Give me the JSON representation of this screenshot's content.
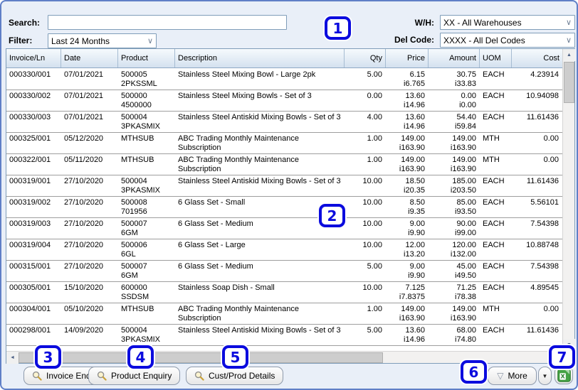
{
  "filters": {
    "search_label": "Search:",
    "search_value": "",
    "filter_label": "Filter:",
    "filter_value": "Last 24 Months",
    "wh_label": "W/H:",
    "wh_value": "XX - All Warehouses",
    "delcode_label": "Del Code:",
    "delcode_value": "XXXX - All Del Codes"
  },
  "table": {
    "columns": [
      "Invoice/Ln",
      "Date",
      "Product",
      "Description",
      "Qty",
      "Price",
      "Amount",
      "UOM",
      "Cost"
    ],
    "rows": [
      {
        "invoice": "000330/001",
        "date": "07/01/2021",
        "product": [
          "500005",
          "2PKSSML"
        ],
        "description": "Stainless Steel Mixing Bowl - Large 2pk",
        "qty": "5.00",
        "price": [
          "6.15",
          "i6.765"
        ],
        "amount": [
          "30.75",
          "i33.83"
        ],
        "uom": "EACH",
        "cost": "4.23914"
      },
      {
        "invoice": "000330/002",
        "date": "07/01/2021",
        "product": [
          "500000",
          "4500000"
        ],
        "description": "Stainless Steel Mixing Bowls - Set of 3",
        "qty": "0.00",
        "price": [
          "13.60",
          "i14.96"
        ],
        "amount": [
          "0.00",
          "i0.00"
        ],
        "uom": "EACH",
        "cost": "10.94098"
      },
      {
        "invoice": "000330/003",
        "date": "07/01/2021",
        "product": [
          "500004",
          "3PKASMIX"
        ],
        "description": "Stainless Steel Antiskid Mixing Bowls - Set of 3",
        "qty": "4.00",
        "price": [
          "13.60",
          "i14.96"
        ],
        "amount": [
          "54.40",
          "i59.84"
        ],
        "uom": "EACH",
        "cost": "11.61436"
      },
      {
        "invoice": "000325/001",
        "date": "05/12/2020",
        "product": [
          "MTHSUB"
        ],
        "description": "ABC Trading Monthly Maintenance Subscription",
        "qty": "1.00",
        "price": [
          "149.00",
          "i163.90"
        ],
        "amount": [
          "149.00",
          "i163.90"
        ],
        "uom": "MTH",
        "cost": "0.00"
      },
      {
        "invoice": "000322/001",
        "date": "05/11/2020",
        "product": [
          "MTHSUB"
        ],
        "description": "ABC Trading Monthly Maintenance Subscription",
        "qty": "1.00",
        "price": [
          "149.00",
          "i163.90"
        ],
        "amount": [
          "149.00",
          "i163.90"
        ],
        "uom": "MTH",
        "cost": "0.00"
      },
      {
        "invoice": "000319/001",
        "date": "27/10/2020",
        "product": [
          "500004",
          "3PKASMIX"
        ],
        "description": "Stainless Steel Antiskid Mixing Bowls - Set of 3",
        "qty": "10.00",
        "price": [
          "18.50",
          "i20.35"
        ],
        "amount": [
          "185.00",
          "i203.50"
        ],
        "uom": "EACH",
        "cost": "11.61436"
      },
      {
        "invoice": "000319/002",
        "date": "27/10/2020",
        "product": [
          "500008",
          "701956"
        ],
        "description": "6 Glass Set - Small",
        "qty": "10.00",
        "price": [
          "8.50",
          "i9.35"
        ],
        "amount": [
          "85.00",
          "i93.50"
        ],
        "uom": "EACH",
        "cost": "5.56101"
      },
      {
        "invoice": "000319/003",
        "date": "27/10/2020",
        "product": [
          "500007",
          "6GM"
        ],
        "description": "6 Glass Set - Medium",
        "qty": "10.00",
        "price": [
          "9.00",
          "i9.90"
        ],
        "amount": [
          "90.00",
          "i99.00"
        ],
        "uom": "EACH",
        "cost": "7.54398"
      },
      {
        "invoice": "000319/004",
        "date": "27/10/2020",
        "product": [
          "500006",
          "6GL"
        ],
        "description": "6 Glass Set - Large",
        "qty": "10.00",
        "price": [
          "12.00",
          "i13.20"
        ],
        "amount": [
          "120.00",
          "i132.00"
        ],
        "uom": "EACH",
        "cost": "10.88748"
      },
      {
        "invoice": "000315/001",
        "date": "27/10/2020",
        "product": [
          "500007",
          "6GM"
        ],
        "description": "6 Glass Set - Medium",
        "qty": "5.00",
        "price": [
          "9.00",
          "i9.90"
        ],
        "amount": [
          "45.00",
          "i49.50"
        ],
        "uom": "EACH",
        "cost": "7.54398"
      },
      {
        "invoice": "000305/001",
        "date": "15/10/2020",
        "product": [
          "600000",
          "SSDSM"
        ],
        "description": "Stainless Soap Dish - Small",
        "qty": "10.00",
        "price": [
          "7.125",
          "i7.8375"
        ],
        "amount": [
          "71.25",
          "i78.38"
        ],
        "uom": "EACH",
        "cost": "4.89545"
      },
      {
        "invoice": "000304/001",
        "date": "05/10/2020",
        "product": [
          "MTHSUB"
        ],
        "description": "ABC Trading Monthly Maintenance Subscription",
        "qty": "1.00",
        "price": [
          "149.00",
          "i163.90"
        ],
        "amount": [
          "149.00",
          "i163.90"
        ],
        "uom": "MTH",
        "cost": "0.00"
      },
      {
        "invoice": "000298/001",
        "date": "14/09/2020",
        "product": [
          "500004",
          "3PKASMIX"
        ],
        "description": "Stainless Steel Antiskid Mixing Bowls - Set of 3",
        "qty": "5.00",
        "price": [
          "13.60",
          "i14.96"
        ],
        "amount": [
          "68.00",
          "i74.80"
        ],
        "uom": "EACH",
        "cost": "11.61436"
      }
    ]
  },
  "buttons": {
    "invoice_enq": "Invoice Enq",
    "product_enquiry": "Product Enquiry",
    "cust_prod_details": "Cust/Prod Details",
    "more": "More"
  },
  "icons": {
    "more_triangle": "▽",
    "dropdown_arrow": "▼",
    "select_chevron": "∨",
    "scroll_up": "▲",
    "scroll_down": "▼",
    "scroll_left": "◄"
  },
  "callouts": [
    "1",
    "2",
    "3",
    "4",
    "5",
    "6",
    "7"
  ],
  "colors": {
    "callout_blue": "#0B0BDE",
    "window_border": "#5F7FC7",
    "panel_background": "#E9EFF8",
    "excel_green": "#44A244"
  }
}
